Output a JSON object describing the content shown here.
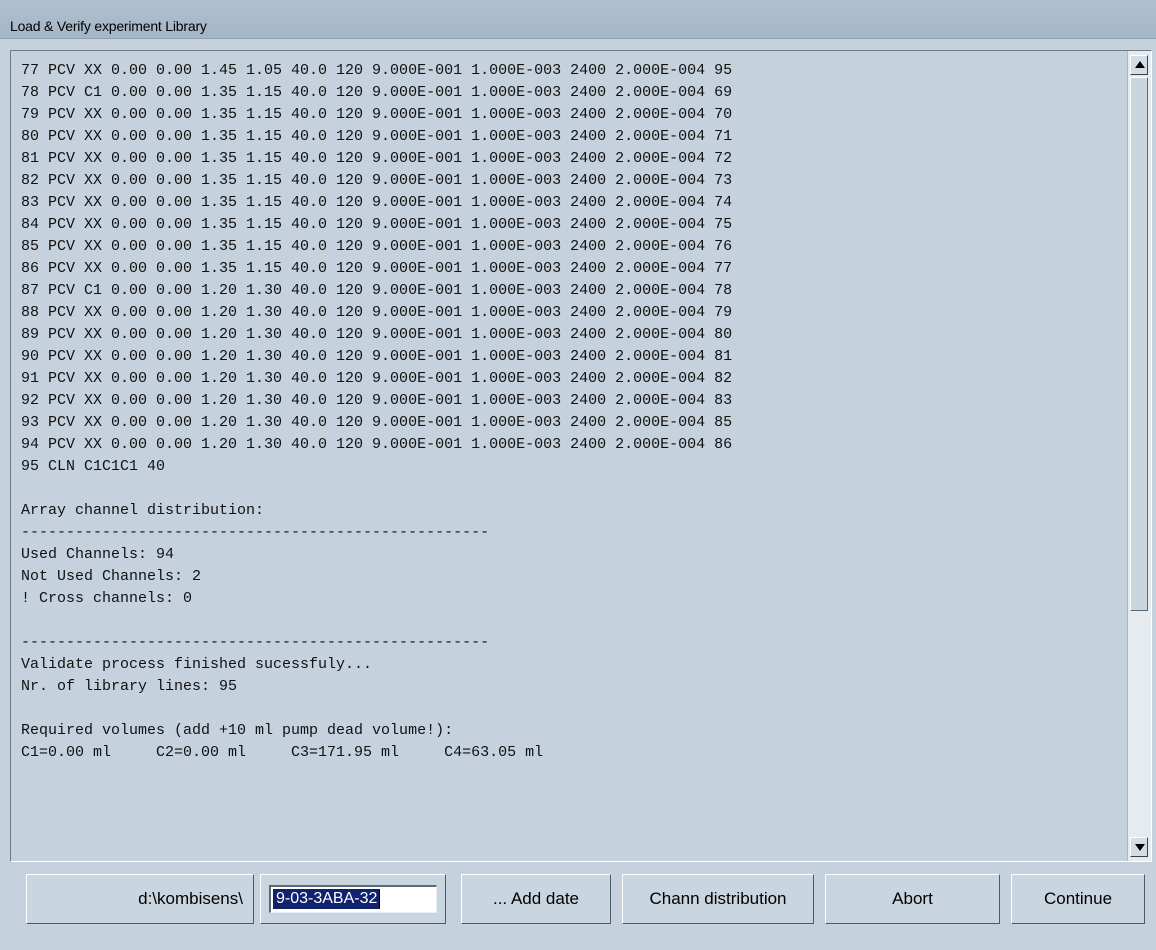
{
  "window": {
    "title": "Load & Verify experiment Library"
  },
  "log": {
    "lines": [
      "77 PCV XX 0.00 0.00 1.45 1.05 40.0 120 9.000E-001 1.000E-003 2400 2.000E-004 95",
      "78 PCV C1 0.00 0.00 1.35 1.15 40.0 120 9.000E-001 1.000E-003 2400 2.000E-004 69",
      "79 PCV XX 0.00 0.00 1.35 1.15 40.0 120 9.000E-001 1.000E-003 2400 2.000E-004 70",
      "80 PCV XX 0.00 0.00 1.35 1.15 40.0 120 9.000E-001 1.000E-003 2400 2.000E-004 71",
      "81 PCV XX 0.00 0.00 1.35 1.15 40.0 120 9.000E-001 1.000E-003 2400 2.000E-004 72",
      "82 PCV XX 0.00 0.00 1.35 1.15 40.0 120 9.000E-001 1.000E-003 2400 2.000E-004 73",
      "83 PCV XX 0.00 0.00 1.35 1.15 40.0 120 9.000E-001 1.000E-003 2400 2.000E-004 74",
      "84 PCV XX 0.00 0.00 1.35 1.15 40.0 120 9.000E-001 1.000E-003 2400 2.000E-004 75",
      "85 PCV XX 0.00 0.00 1.35 1.15 40.0 120 9.000E-001 1.000E-003 2400 2.000E-004 76",
      "86 PCV XX 0.00 0.00 1.35 1.15 40.0 120 9.000E-001 1.000E-003 2400 2.000E-004 77",
      "87 PCV C1 0.00 0.00 1.20 1.30 40.0 120 9.000E-001 1.000E-003 2400 2.000E-004 78",
      "88 PCV XX 0.00 0.00 1.20 1.30 40.0 120 9.000E-001 1.000E-003 2400 2.000E-004 79",
      "89 PCV XX 0.00 0.00 1.20 1.30 40.0 120 9.000E-001 1.000E-003 2400 2.000E-004 80",
      "90 PCV XX 0.00 0.00 1.20 1.30 40.0 120 9.000E-001 1.000E-003 2400 2.000E-004 81",
      "91 PCV XX 0.00 0.00 1.20 1.30 40.0 120 9.000E-001 1.000E-003 2400 2.000E-004 82",
      "92 PCV XX 0.00 0.00 1.20 1.30 40.0 120 9.000E-001 1.000E-003 2400 2.000E-004 83",
      "93 PCV XX 0.00 0.00 1.20 1.30 40.0 120 9.000E-001 1.000E-003 2400 2.000E-004 85",
      "94 PCV XX 0.00 0.00 1.20 1.30 40.0 120 9.000E-001 1.000E-003 2400 2.000E-004 86",
      "95 CLN C1C1C1 40",
      "",
      "Array channel distribution:",
      "----------------------------------------------------",
      "Used Channels: 94",
      "Not Used Channels: 2",
      "! Cross channels: 0",
      "",
      "----------------------------------------------------",
      "Validate process finished sucessfuly...",
      "Nr. of library lines: 95",
      "",
      "Required volumes (add +10 ml pump dead volume!):",
      "C1=0.00 ml     C2=0.00 ml     C3=171.95 ml     C4=63.05 ml"
    ]
  },
  "footer": {
    "path_label": "d:\\kombisens\\",
    "name_value": "9-03-3ABA-32",
    "add_date_label": "... Add date",
    "chann_distribution_label": "Chann distribution",
    "abort_label": "Abort",
    "continue_label": "Continue"
  },
  "colors": {
    "background": "#c5d2dd",
    "titlebar": "#a9bacb",
    "selection": "#10216e"
  }
}
